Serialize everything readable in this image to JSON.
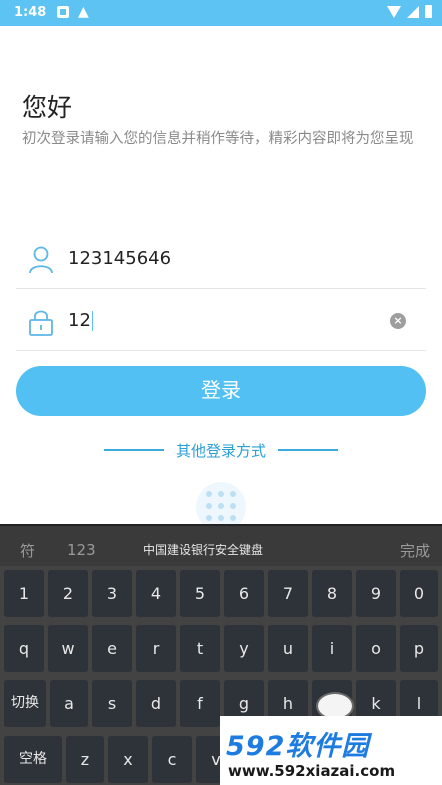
{
  "status_bar": {
    "time": "1:48"
  },
  "page": {
    "greeting": "您好",
    "intro": "初次登录请输入您的信息并稍作等待，精彩内容即将为您呈现"
  },
  "form": {
    "username_value": "123145646",
    "password_value": "12",
    "login_label": "登录",
    "other_login_label": "其他登录方式"
  },
  "keyboard": {
    "symbol_tab": "符",
    "number_tab": "123",
    "title": "中国建设银行安全键盘",
    "done_label": "完成",
    "rows": [
      [
        "1",
        "2",
        "3",
        "4",
        "5",
        "6",
        "7",
        "8",
        "9",
        "0"
      ],
      [
        "q",
        "w",
        "e",
        "r",
        "t",
        "y",
        "u",
        "i",
        "o",
        "p"
      ],
      [
        "切换",
        "a",
        "s",
        "d",
        "f",
        "g",
        "h",
        "j",
        "k",
        "l"
      ],
      [
        "空格",
        "z",
        "x",
        "c",
        "v"
      ]
    ]
  },
  "watermark": {
    "brand": "592软件园",
    "url": "www.592xiazai.com"
  },
  "colors": {
    "accent": "#52c0f2",
    "status_bar": "#5cc3f2",
    "keyboard_bg": "#434343",
    "key_bg": "#2e3339"
  }
}
